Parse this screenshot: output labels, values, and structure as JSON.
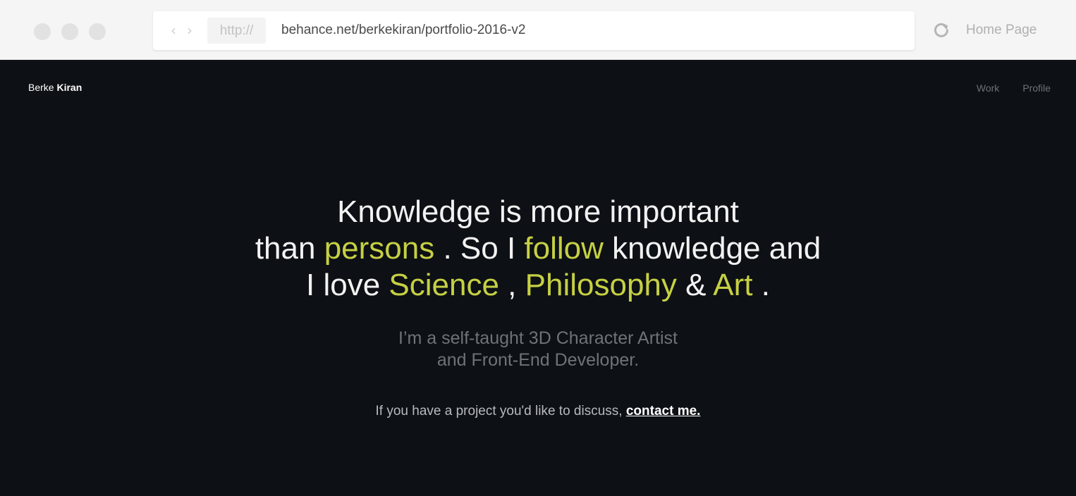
{
  "browser": {
    "url_protocol": "http://",
    "url": "behance.net/berkekiran/portfolio-2016-v2",
    "home_label": "Home Page",
    "back_icon": "chevron-left-icon",
    "forward_icon": "chevron-right-icon",
    "reload_icon": "reload-icon"
  },
  "site": {
    "brand_first": "Berke",
    "brand_last": "Kiran",
    "nav": [
      {
        "label": "Work"
      },
      {
        "label": "Profile"
      }
    ],
    "hero": {
      "line1": "Knowledge is more important",
      "line2_a": "than ",
      "line2_b": "persons",
      "line2_c": " . So I ",
      "line2_d": "follow",
      "line2_e": " knowledge and",
      "line3_a": "I love ",
      "line3_b": "Science",
      "line3_c": " , ",
      "line3_d": "Philosophy",
      "line3_e": " & ",
      "line3_f": "Art",
      "line3_g": " ."
    },
    "subtitle_line1": "I’m a self-taught 3D Character Artist",
    "subtitle_line2": "and Front-End Developer.",
    "cta_text": "If you have a project you'd like to discuss, ",
    "cta_link": "contact me."
  },
  "colors": {
    "accent": "#c6d043",
    "background": "#0d1014"
  }
}
